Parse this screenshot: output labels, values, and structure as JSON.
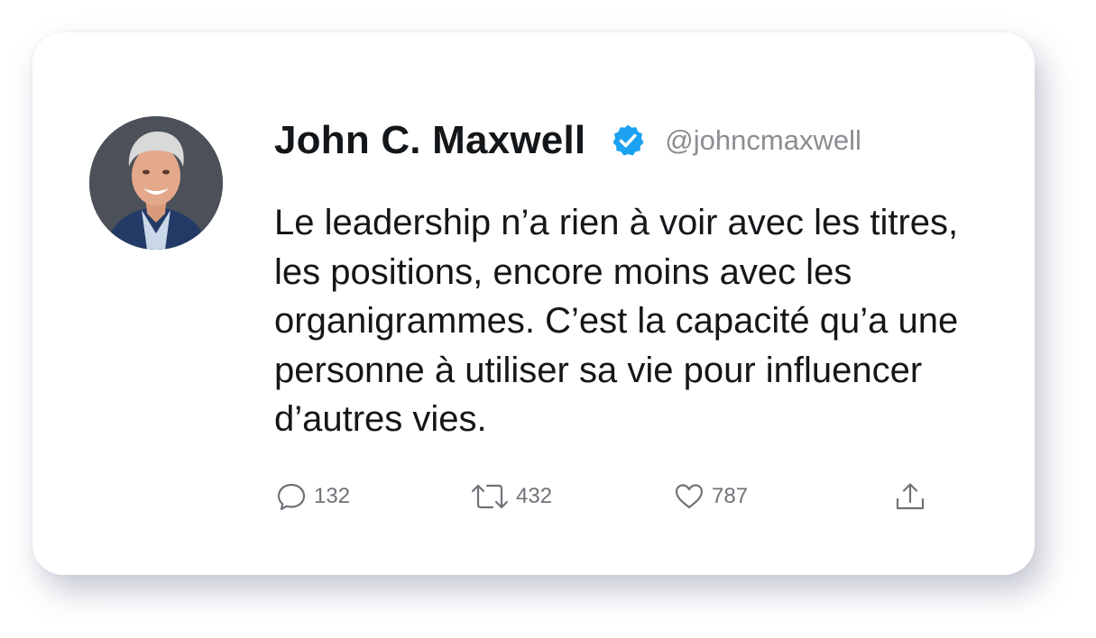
{
  "tweet": {
    "author": {
      "display_name": "John C. Maxwell",
      "handle": "@johncmaxwell",
      "verified_icon": "verified-badge-icon",
      "avatar_icon": "avatar-photo"
    },
    "text": "Le leadership n’a rien à voir avec les titres, les positions, encore moins avec les organigrammes. C’est la capacité qu’a une personne à utiliser sa vie pour influencer d’autres vies.",
    "actions": {
      "reply": {
        "icon": "reply-icon",
        "count": "132"
      },
      "retweet": {
        "icon": "retweet-icon",
        "count": "432"
      },
      "like": {
        "icon": "heart-icon",
        "count": "787"
      },
      "share": {
        "icon": "share-icon"
      }
    }
  },
  "colors": {
    "verified_blue": "#1da1f2",
    "text_primary": "#14171a",
    "text_secondary": "#8a8d91",
    "icon_gray": "#6e7378"
  }
}
